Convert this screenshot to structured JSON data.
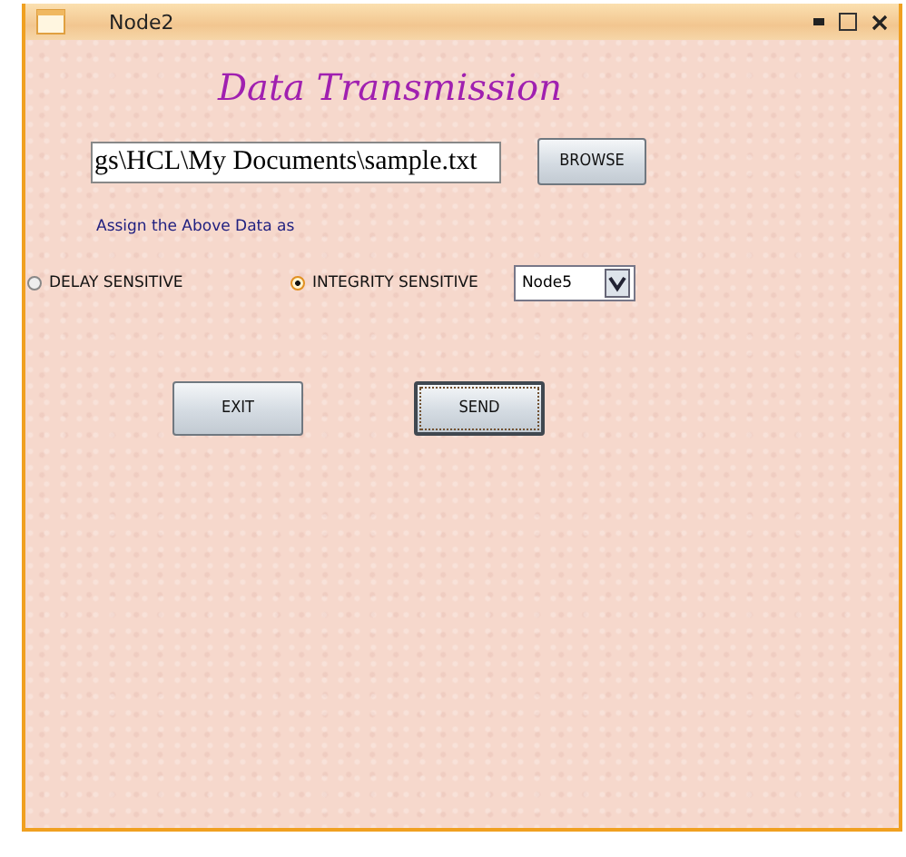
{
  "window": {
    "title": "Node2"
  },
  "heading": "Data Transmission",
  "file_field": {
    "value": "gs\\HCL\\My Documents\\sample.txt"
  },
  "browse_button": "BROWSE",
  "assign_label": "Assign the Above Data as",
  "options": [
    {
      "label": "DELAY SENSITIVE",
      "selected": false
    },
    {
      "label": "INTEGRITY SENSITIVE",
      "selected": true
    }
  ],
  "node_select": {
    "value": "Node5"
  },
  "buttons": [
    {
      "label": "EXIT",
      "focused": false
    },
    {
      "label": "SEND",
      "focused": true
    }
  ]
}
